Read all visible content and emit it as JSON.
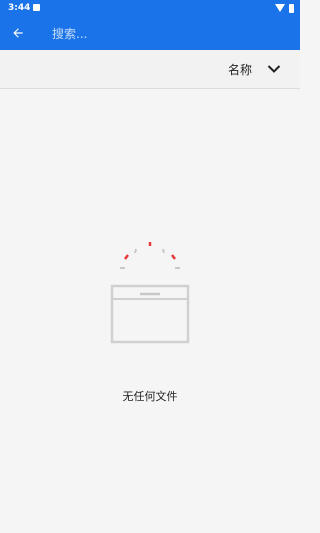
{
  "status_bar": {
    "time": "3:44"
  },
  "app_bar": {
    "search_placeholder": "搜索..."
  },
  "sort_bar": {
    "sort_label": "名称"
  },
  "empty_state": {
    "message": "无任何文件"
  },
  "colors": {
    "primary": "#1a73e8",
    "accent_red": "#e53935",
    "outline_gray": "#d0d0d0"
  }
}
